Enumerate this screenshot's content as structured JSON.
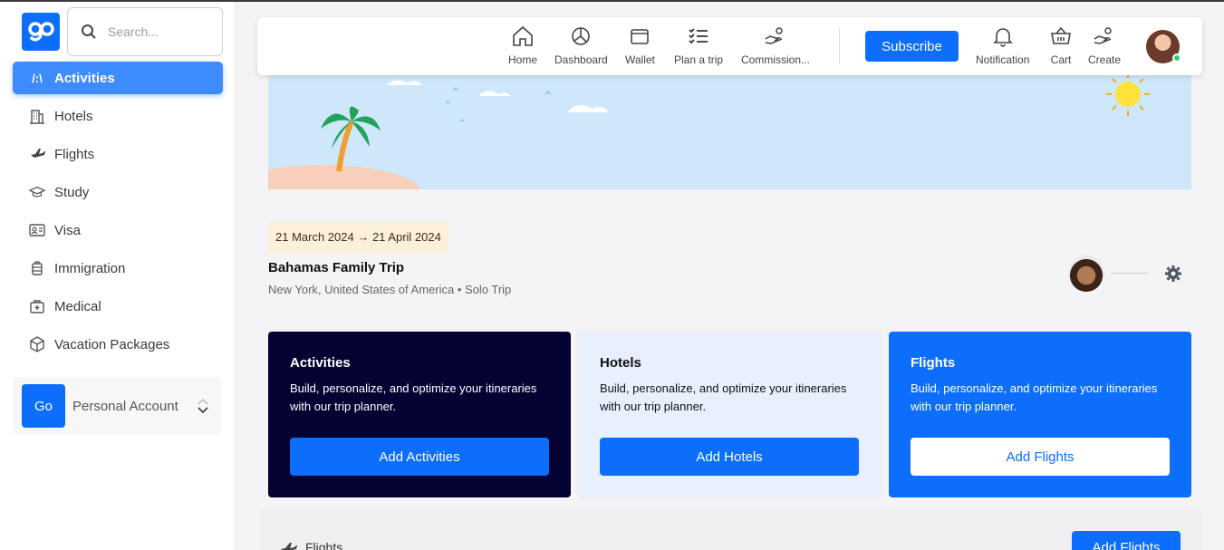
{
  "brand": {
    "logo_text": "go",
    "accent": "#0d6efd"
  },
  "search": {
    "placeholder": "Search..."
  },
  "sidebar": {
    "items": [
      {
        "label": "Activities",
        "icon": "activities-icon",
        "active": true
      },
      {
        "label": "Hotels",
        "icon": "hotel-icon"
      },
      {
        "label": "Flights",
        "icon": "plane-icon"
      },
      {
        "label": "Study",
        "icon": "graduation-cap-icon"
      },
      {
        "label": "Visa",
        "icon": "id-card-icon"
      },
      {
        "label": "Immigration",
        "icon": "luggage-icon"
      },
      {
        "label": "Medical",
        "icon": "medical-kit-icon"
      },
      {
        "label": "Vacation Packages",
        "icon": "package-icon"
      }
    ],
    "account": {
      "badge": "Go",
      "name": "Personal Account"
    }
  },
  "topbar": {
    "items": [
      {
        "label": "Home",
        "icon": "home-icon"
      },
      {
        "label": "Dashboard",
        "icon": "pie-chart-icon"
      },
      {
        "label": "Wallet",
        "icon": "wallet-icon"
      },
      {
        "label": "Plan a trip",
        "icon": "checklist-icon"
      },
      {
        "label": "Commission...",
        "icon": "hand-coins-icon"
      }
    ],
    "subscribe": "Subscribe",
    "right_items": [
      {
        "label": "Notification",
        "icon": "bell-icon"
      },
      {
        "label": "Cart",
        "icon": "basket-icon"
      },
      {
        "label": "Create",
        "icon": "hand-coins-icon"
      }
    ]
  },
  "trip": {
    "date_range": "21 March 2024 → 21 April 2024",
    "title": "Bahamas Family Trip",
    "subtitle": "New York, United States of America • Solo Trip"
  },
  "cards": [
    {
      "title": "Activities",
      "desc": "Build, personalize, and optimize your itineraries with our trip planner.",
      "button": "Add Activities"
    },
    {
      "title": "Hotels",
      "desc": "Build, personalize, and optimize your itineraries with our trip planner.",
      "button": "Add Hotels"
    },
    {
      "title": "Flights",
      "desc": "Build, personalize, and optimize your itineraries with our trip planner.",
      "button": "Add Flights"
    }
  ],
  "bottom": {
    "section_label": "Flights",
    "button": "Add Flights"
  }
}
